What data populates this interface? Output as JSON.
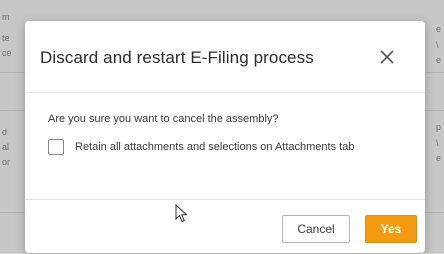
{
  "dialog": {
    "title": "Discard and restart E-Filing process",
    "question": "Are you sure you want to cancel the assembly?",
    "retain_checkbox": {
      "label": "Retain all attachments and selections on Attachments tab",
      "checked": false
    },
    "cancel_label": "Cancel",
    "yes_label": "Yes",
    "close_icon": "close-icon"
  },
  "colors": {
    "primary_button": "#f39c12",
    "title_text": "#2b2b2b",
    "body_text": "#3a3a3a"
  },
  "background_fragments": {
    "left": [
      "m",
      "te",
      "ce",
      "d",
      "al",
      "or"
    ],
    "right": [
      "e",
      "\\",
      "e",
      "p",
      "\\",
      "e"
    ]
  }
}
